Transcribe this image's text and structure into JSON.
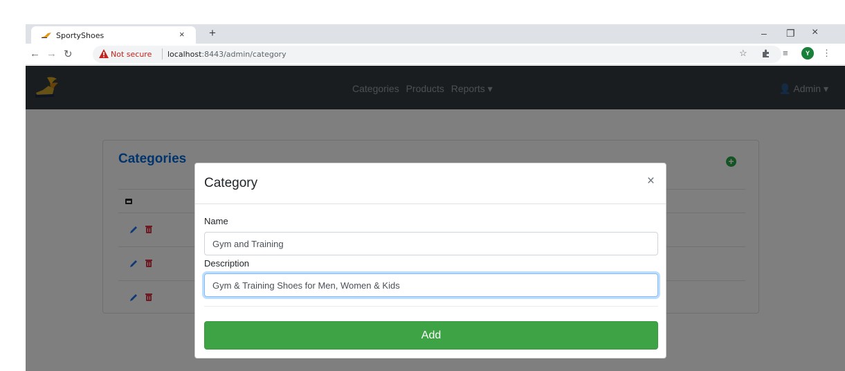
{
  "browser": {
    "tab_title": "SportyShoes",
    "tab_close": "×",
    "new_tab": "+",
    "not_secure": "Not secure",
    "url_host": "localhost",
    "url_path": ":8443/admin/category",
    "profile_initial": "Y",
    "window_controls": {
      "minimize": "–",
      "restore": "❐",
      "close": "×"
    }
  },
  "navbar": {
    "links": [
      "Categories",
      "Products",
      "Reports ▾"
    ],
    "user": "Admin ▾"
  },
  "card": {
    "title": "Categories",
    "add_icon": "+"
  },
  "modal": {
    "title": "Category",
    "close": "×",
    "name_label": "Name",
    "name_value": "Gym and Training",
    "description_label": "Description",
    "description_value": "Gym & Training Shoes for Men, Women & Kids",
    "submit_label": "Add"
  },
  "colors": {
    "navbar": "#343a40",
    "title_blue": "#0069d9",
    "add_green": "#3da345",
    "danger": "#dc3545"
  }
}
